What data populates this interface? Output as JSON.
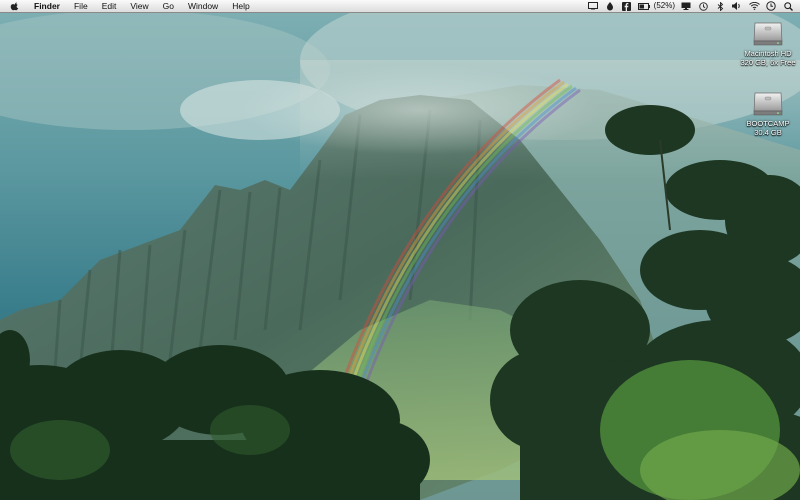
{
  "menubar": {
    "app_name": "Finder",
    "menus": [
      "File",
      "Edit",
      "View",
      "Go",
      "Window",
      "Help"
    ],
    "status_icons": [
      "screen-mirroring-icon",
      "dropbox-icon",
      "facebook-icon",
      "battery-icon",
      "display-icon",
      "time-machine-icon",
      "bluetooth-icon",
      "volume-icon",
      "wifi-icon",
      "clock-icon",
      "spotlight-icon"
    ],
    "battery_percent": "(52%)"
  },
  "desktop": {
    "drives": [
      {
        "name": "Macintosh HD",
        "size": "320 GB, 6x Free"
      },
      {
        "name": "BOOTCAMP",
        "size": "30.4 GB"
      }
    ]
  },
  "colors": {
    "sky": "#5d9aa2",
    "mountain": "#4f7063",
    "foliage": "#1f3a24",
    "menubar": "#eeeeee"
  }
}
